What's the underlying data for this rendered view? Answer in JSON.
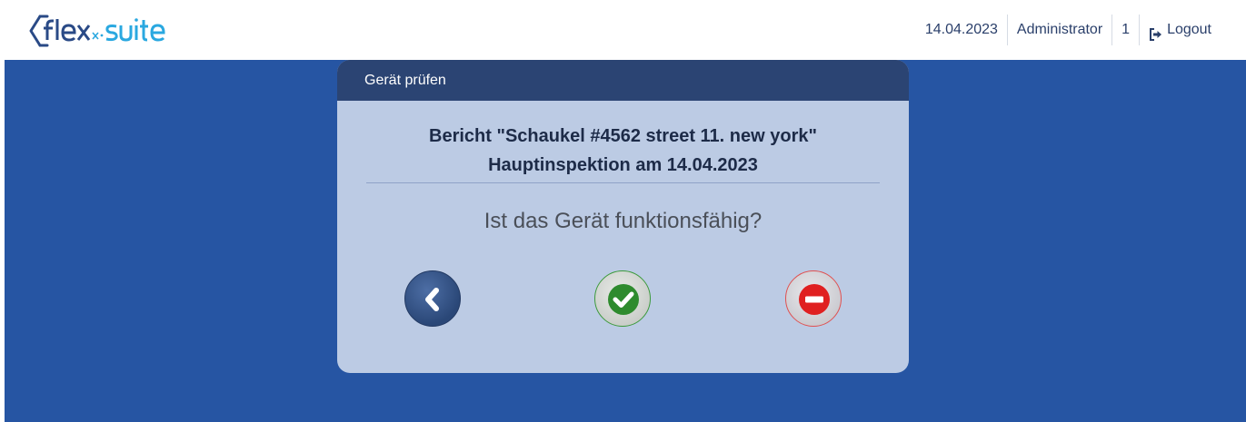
{
  "header": {
    "logo_text": "flex-suite",
    "date": "14.04.2023",
    "user": "Administrator",
    "count": "1",
    "logout_label": "Logout"
  },
  "dialog": {
    "title": "Gerät prüfen",
    "report_line1": "Bericht \"Schaukel #4562 street 11. new york\"",
    "report_line2": "Hauptinspektion am 14.04.2023",
    "question": "Ist das Gerät funktionsfähig?"
  },
  "colors": {
    "background": "#2655a3",
    "dialog_bg": "#bccbe4",
    "dialog_header": "#2b4473",
    "ok_green": "#2e8b2e",
    "no_red": "#e02020"
  },
  "icons": {
    "back": "chevron-left-icon",
    "ok": "checkmark-icon",
    "no": "minus-circle-icon",
    "logout": "sign-out-icon"
  }
}
